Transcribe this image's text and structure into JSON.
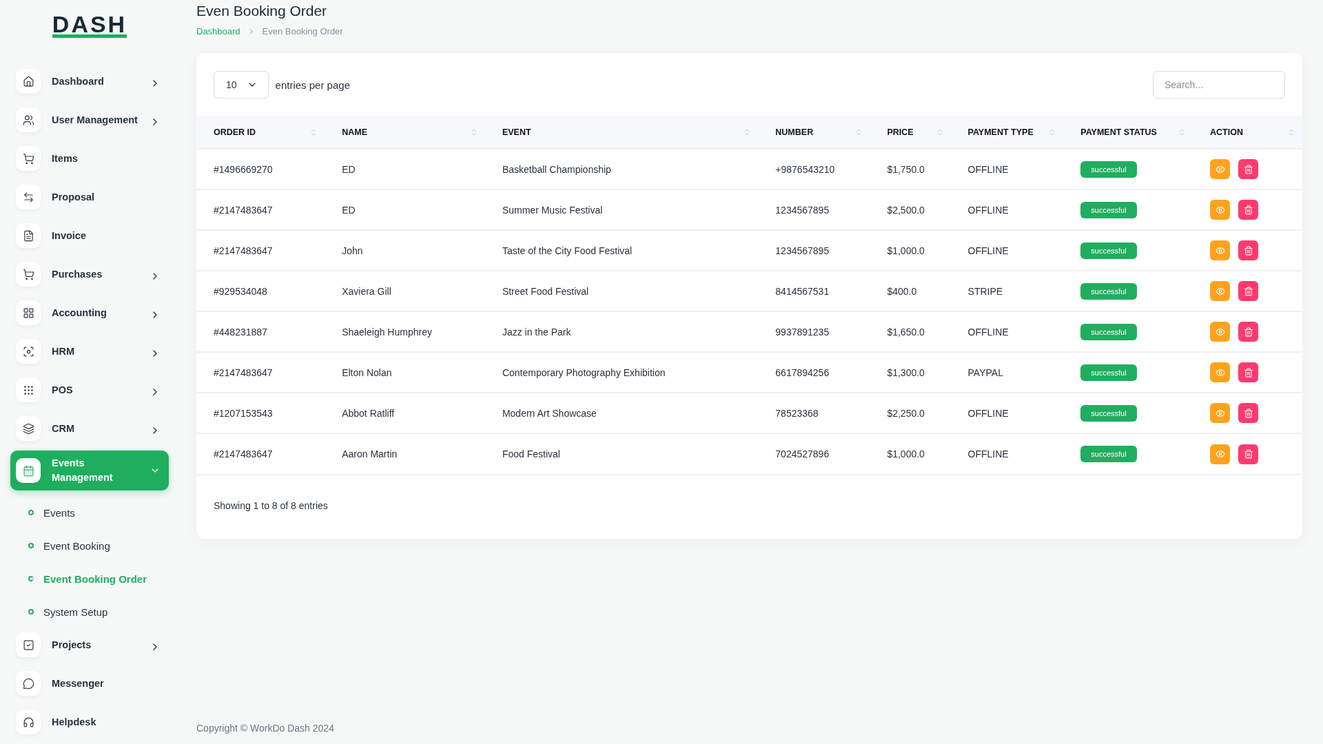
{
  "logo": {
    "text": "DASH"
  },
  "sidebar": {
    "items": [
      {
        "label": "Dashboard",
        "expanded": false,
        "selected": false
      },
      {
        "label": "User Management",
        "expanded": false,
        "selected": false
      },
      {
        "label": "Items",
        "selected": false
      },
      {
        "label": "Proposal",
        "selected": false
      },
      {
        "label": "Invoice",
        "selected": false
      },
      {
        "label": "Purchases",
        "expanded": false,
        "selected": false
      },
      {
        "label": "Accounting",
        "expanded": false,
        "selected": false
      },
      {
        "label": "HRM",
        "expanded": false,
        "selected": false
      },
      {
        "label": "POS",
        "expanded": false,
        "selected": false
      },
      {
        "label": "CRM",
        "expanded": false,
        "selected": false
      },
      {
        "label": "Events Management",
        "expanded": true,
        "selected": true,
        "children": [
          {
            "label": "Events",
            "selected": false
          },
          {
            "label": "Event Booking",
            "selected": false
          },
          {
            "label": "Event Booking Order",
            "selected": true
          },
          {
            "label": "System Setup",
            "selected": false
          }
        ]
      },
      {
        "label": "Projects",
        "expanded": false,
        "selected": false
      },
      {
        "label": "Messenger",
        "selected": false
      },
      {
        "label": "Helpdesk",
        "selected": false
      }
    ]
  },
  "page": {
    "title": "Even Booking Order",
    "breadcrumb": [
      {
        "label": "Dashboard",
        "selected": false
      },
      {
        "label": "Even Booking Order",
        "selected": true
      }
    ]
  },
  "table_controls": {
    "per_page": "10",
    "per_page_label": "entries per page",
    "search": {
      "placeholder": "Search..."
    }
  },
  "table": {
    "columns": [
      "ORDER ID",
      "NAME",
      "EVENT",
      "NUMBER",
      "PRICE",
      "PAYMENT TYPE",
      "PAYMENT STATUS",
      "ACTION"
    ],
    "rows": [
      {
        "order_id": "#1496669270",
        "name": "ED",
        "event": "Basketball Championship",
        "number": "+9876543210",
        "price": "$1,750.0",
        "payment_type": "OFFLINE",
        "payment_status": "successful"
      },
      {
        "order_id": "#2147483647",
        "name": "ED",
        "event": "Summer Music Festival",
        "number": "1234567895",
        "price": "$2,500.0",
        "payment_type": "OFFLINE",
        "payment_status": "successful"
      },
      {
        "order_id": "#2147483647",
        "name": "John",
        "event": "Taste of the City Food Festival",
        "number": "1234567895",
        "price": "$1,000.0",
        "payment_type": "OFFLINE",
        "payment_status": "successful"
      },
      {
        "order_id": "#929534048",
        "name": "Xaviera Gill",
        "event": "Street Food Festival",
        "number": "8414567531",
        "price": "$400.0",
        "payment_type": "STRIPE",
        "payment_status": "successful"
      },
      {
        "order_id": "#448231887",
        "name": "Shaeleigh Humphrey",
        "event": "Jazz in the Park",
        "number": "9937891235",
        "price": "$1,650.0",
        "payment_type": "OFFLINE",
        "payment_status": "successful"
      },
      {
        "order_id": "#2147483647",
        "name": "Elton Nolan",
        "event": "Contemporary Photography Exhibition",
        "number": "6617894256",
        "price": "$1,300.0",
        "payment_type": "PAYPAL",
        "payment_status": "successful"
      },
      {
        "order_id": "#1207153543",
        "name": "Abbot Ratliff",
        "event": "Modern Art Showcase",
        "number": "78523368",
        "price": "$2,250.0",
        "payment_type": "OFFLINE",
        "payment_status": "successful"
      },
      {
        "order_id": "#2147483647",
        "name": "Aaron Martin",
        "event": "Food Festival",
        "number": "7024527896",
        "price": "$1,000.0",
        "payment_type": "OFFLINE",
        "payment_status": "successful"
      }
    ],
    "summary": "Showing 1 to 8 of 8 entries"
  },
  "footer": {
    "copyright": "Copyright © WorkDo Dash 2024"
  }
}
